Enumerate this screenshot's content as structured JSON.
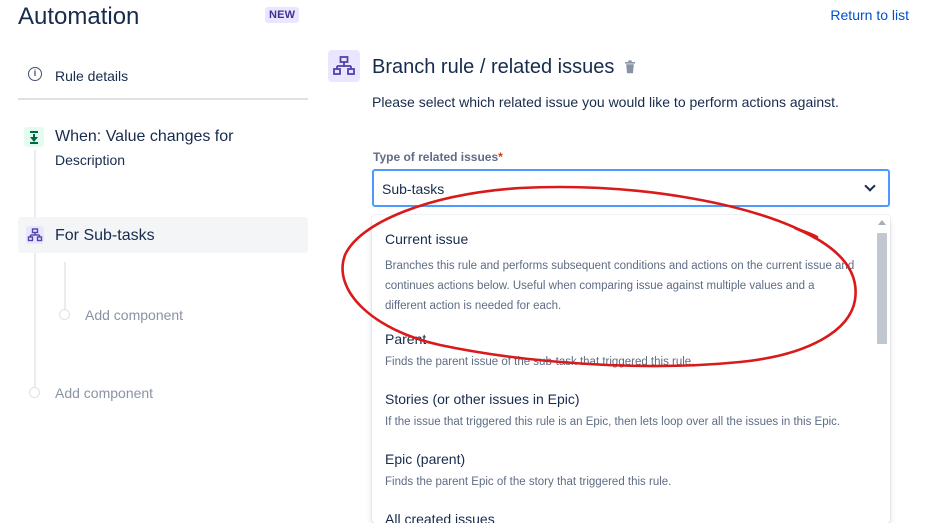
{
  "header": {
    "title": "Automation",
    "badge": "NEW",
    "return_link": "Return to list"
  },
  "sidebar": {
    "rule_details": "Rule details",
    "trigger": {
      "title": "When: Value changes for",
      "subtitle": "Description"
    },
    "branch": {
      "label": "For Sub-tasks"
    },
    "add_component_inner": "Add component",
    "add_component_outer": "Add component"
  },
  "panel": {
    "heading": "Branch rule / related issues",
    "description": "Please select which related issue you would like to perform actions against.",
    "field_label": "Type of related issues",
    "required_mark": "*",
    "select_value": "Sub-tasks"
  },
  "dropdown": {
    "options": [
      {
        "title": "Current issue",
        "description": "Branches this rule and performs subsequent conditions and actions on the current issue and continues actions below. Useful when comparing issue against multiple values and a different action is needed for each."
      },
      {
        "title": "Parent",
        "description": "Finds the parent issue of the sub-task that triggered this rule."
      },
      {
        "title": "Stories (or other issues in Epic)",
        "description": "If the issue that triggered this rule is an Epic, then lets loop over all the issues in this Epic."
      },
      {
        "title": "Epic (parent)",
        "description": "Finds the parent Epic of the story that triggered this rule."
      },
      {
        "title": "All created issues",
        "description": ""
      }
    ]
  },
  "colors": {
    "link": "#0052cc",
    "focus_border": "#4c9aff",
    "annotation": "#d91a1a",
    "branch_icon_bg": "#eae6ff",
    "branch_icon_fg": "#5243aa",
    "trigger_icon_bg": "#e3fcef"
  }
}
